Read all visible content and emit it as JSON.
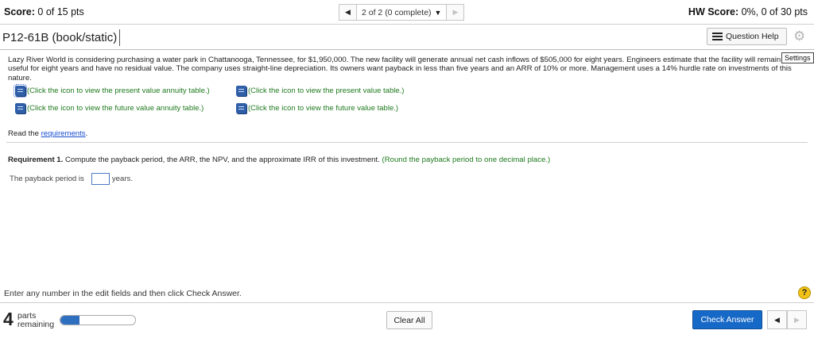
{
  "header": {
    "score_label": "Score:",
    "score_value": "0 of 15 pts",
    "question_position": "2 of 2 (0 complete)",
    "hw_score_label": "HW Score:",
    "hw_score_value": "0%, 0 of 30 pts"
  },
  "question": {
    "title": "P12-61B (book/static)",
    "help_button": "Question Help",
    "settings_tooltip": "Settings"
  },
  "problem_text": "Lazy River World is considering purchasing a water park in Chattanooga, Tennessee, for $1,950,000. The new facility will generate annual net cash inflows of $505,000 for eight years. Engineers estimate that the facility will remain useful for eight years and have no residual value. The company uses straight-line depreciation. Its owners want payback in less than five years and an ARR of 10% or more. Management uses a 14% hurdle rate on investments of this nature.",
  "table_links": [
    "(Click the icon to view the present value annuity table.)",
    "(Click the icon to view the present value table.)",
    "(Click the icon to view the future value annuity table.)",
    "(Click the icon to view the future value table.)"
  ],
  "read_requirements": {
    "prefix": "Read the ",
    "link": "requirements",
    "suffix": "."
  },
  "requirement": {
    "label": "Requirement 1.",
    "text": " Compute the payback period, the ARR, the NPV, and the approximate IRR of this investment. ",
    "hint": "(Round the payback period to one decimal place.)"
  },
  "answer": {
    "prefix": "The payback period is",
    "value": "",
    "suffix": "years."
  },
  "footer": {
    "instructions": "Enter any number in the edit fields and then click Check Answer.",
    "help_symbol": "?",
    "parts_count": "4",
    "parts_word": "parts",
    "remaining_word": "remaining",
    "progress_fraction": 0.25,
    "clear_all": "Clear All",
    "check_answer": "Check Answer"
  },
  "icons": {
    "prev": "◀",
    "next": "▶",
    "dropdown": "▼",
    "gear": "⚙"
  },
  "colors": {
    "accent_blue": "#1769c7",
    "link_green": "#1f7a1f",
    "help_yellow": "#f2c316"
  }
}
